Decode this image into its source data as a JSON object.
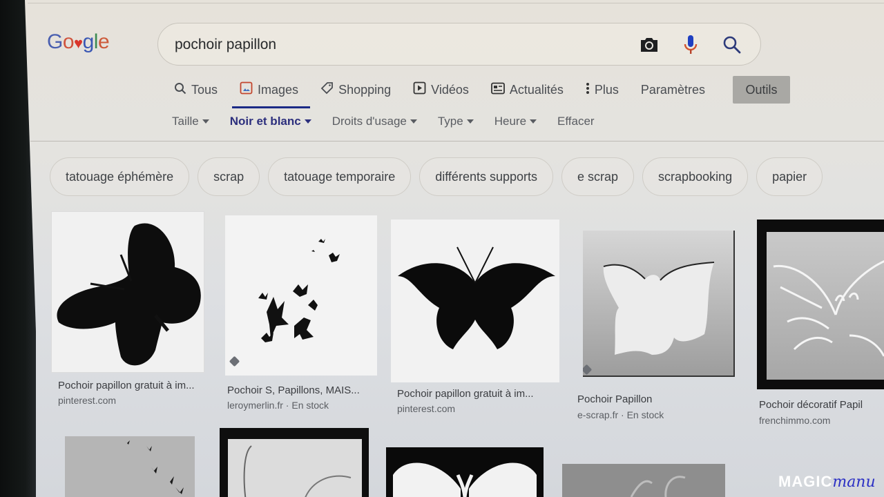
{
  "logo": {
    "parts": [
      "G",
      "o",
      "♥",
      "g",
      "l",
      "e"
    ],
    "alt": "Google"
  },
  "search": {
    "query": "pochoir papillon",
    "icons": [
      "camera-icon",
      "microphone-icon",
      "search-icon"
    ]
  },
  "tabs": [
    {
      "label": "Tous",
      "icon": "search-icon",
      "active": false
    },
    {
      "label": "Images",
      "icon": "image-icon",
      "active": true
    },
    {
      "label": "Shopping",
      "icon": "tag-icon",
      "active": false
    },
    {
      "label": "Vidéos",
      "icon": "play-icon",
      "active": false
    },
    {
      "label": "Actualités",
      "icon": "news-icon",
      "active": false
    },
    {
      "label": "Plus",
      "icon": "more-vert-icon",
      "active": false
    },
    {
      "label": "Paramètres",
      "icon": "",
      "active": false
    }
  ],
  "outils_label": "Outils",
  "tools": [
    {
      "label": "Taille",
      "dropdown": true,
      "selected": false
    },
    {
      "label": "Noir et blanc",
      "dropdown": true,
      "selected": true
    },
    {
      "label": "Droits d'usage",
      "dropdown": true,
      "selected": false
    },
    {
      "label": "Type",
      "dropdown": true,
      "selected": false
    },
    {
      "label": "Heure",
      "dropdown": true,
      "selected": false
    },
    {
      "label": "Effacer",
      "dropdown": false,
      "selected": false
    }
  ],
  "chips": [
    "tatouage éphémère",
    "scrap",
    "tatouage temporaire",
    "différents supports",
    "e scrap",
    "scrapbooking",
    "papier"
  ],
  "results": [
    {
      "title": "Pochoir papillon gratuit à im...",
      "source": "pinterest.com",
      "stock": ""
    },
    {
      "title": "Pochoir S, Papillons, MAIS...",
      "source": "leroymerlin.fr",
      "stock": "En stock"
    },
    {
      "title": "Pochoir papillon gratuit à im...",
      "source": "pinterest.com",
      "stock": ""
    },
    {
      "title": "Pochoir Papillon",
      "source": "e-scrap.fr",
      "stock": "En stock"
    },
    {
      "title": "Pochoir décoratif Papil",
      "source": "frenchimmo.com",
      "stock": ""
    }
  ],
  "watermark": {
    "main": "MAGIC",
    "script": "manu"
  }
}
